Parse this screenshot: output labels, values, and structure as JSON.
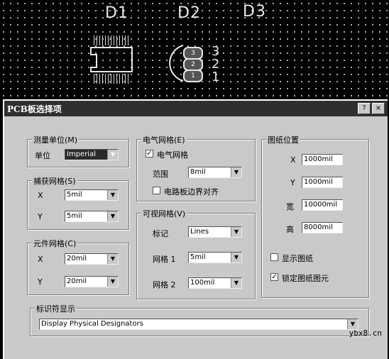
{
  "pcb": {
    "designators": [
      "D1",
      "D2",
      "D3"
    ],
    "pins": [
      "3",
      "2",
      "1"
    ],
    "pad_labels": [
      "3",
      "2",
      "1"
    ]
  },
  "dialog": {
    "title": "PCB板选择项",
    "help_btn": "?",
    "close_btn": "×",
    "measure": {
      "title": "测量单位(M)",
      "unit_label": "单位",
      "unit_value": "Imperial"
    },
    "snap": {
      "title": "捕获网格(S)",
      "x_label": "X",
      "x_value": "5mil",
      "y_label": "Y",
      "y_value": "5mil"
    },
    "component": {
      "title": "元件网格(C)",
      "x_label": "X",
      "x_value": "20mil",
      "y_label": "Y",
      "y_value": "20mil"
    },
    "electric": {
      "title": "电气网格(E)",
      "check_label": "电气网格",
      "range_label": "范围",
      "range_value": "8mil",
      "align_label": "电路板边界对齐"
    },
    "visible": {
      "title": "可视网格(V)",
      "marker_label": "标记",
      "marker_value": "Lines",
      "grid1_label": "网格 1",
      "grid1_value": "5mil",
      "grid2_label": "网格 2",
      "grid2_value": "100mil"
    },
    "sheet": {
      "title": "图纸位置",
      "x_label": "X",
      "x_value": "1000mil",
      "y_label": "Y",
      "y_value": "1000mil",
      "w_label": "宽",
      "w_value": "10000mil",
      "h_label": "高",
      "h_value": "8000mil",
      "show_label": "显示图纸",
      "lock_label": "锁定图纸图元"
    },
    "designator": {
      "title": "标识符显示",
      "value": "Display Physical Designators"
    }
  },
  "watermark": "ybx8.cn"
}
